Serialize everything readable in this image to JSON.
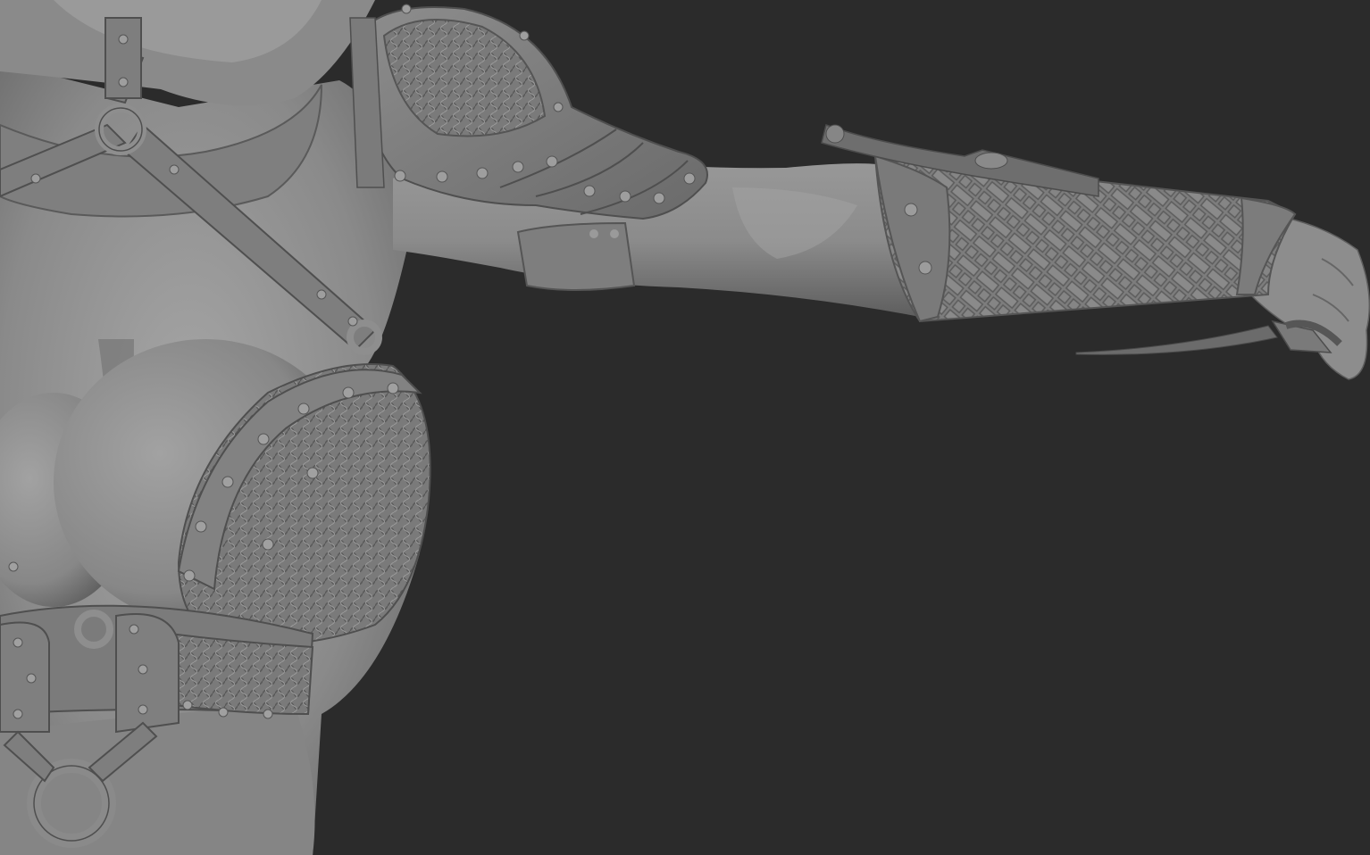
{
  "viewport": {
    "background": "#2b2b2b",
    "model_base_color": "#8c8c8c",
    "model_shadow_color": "#4a4a4a",
    "model_highlight_color": "#b4b4b4"
  },
  "icons": [
    "sculpt-mesh-viewport"
  ]
}
